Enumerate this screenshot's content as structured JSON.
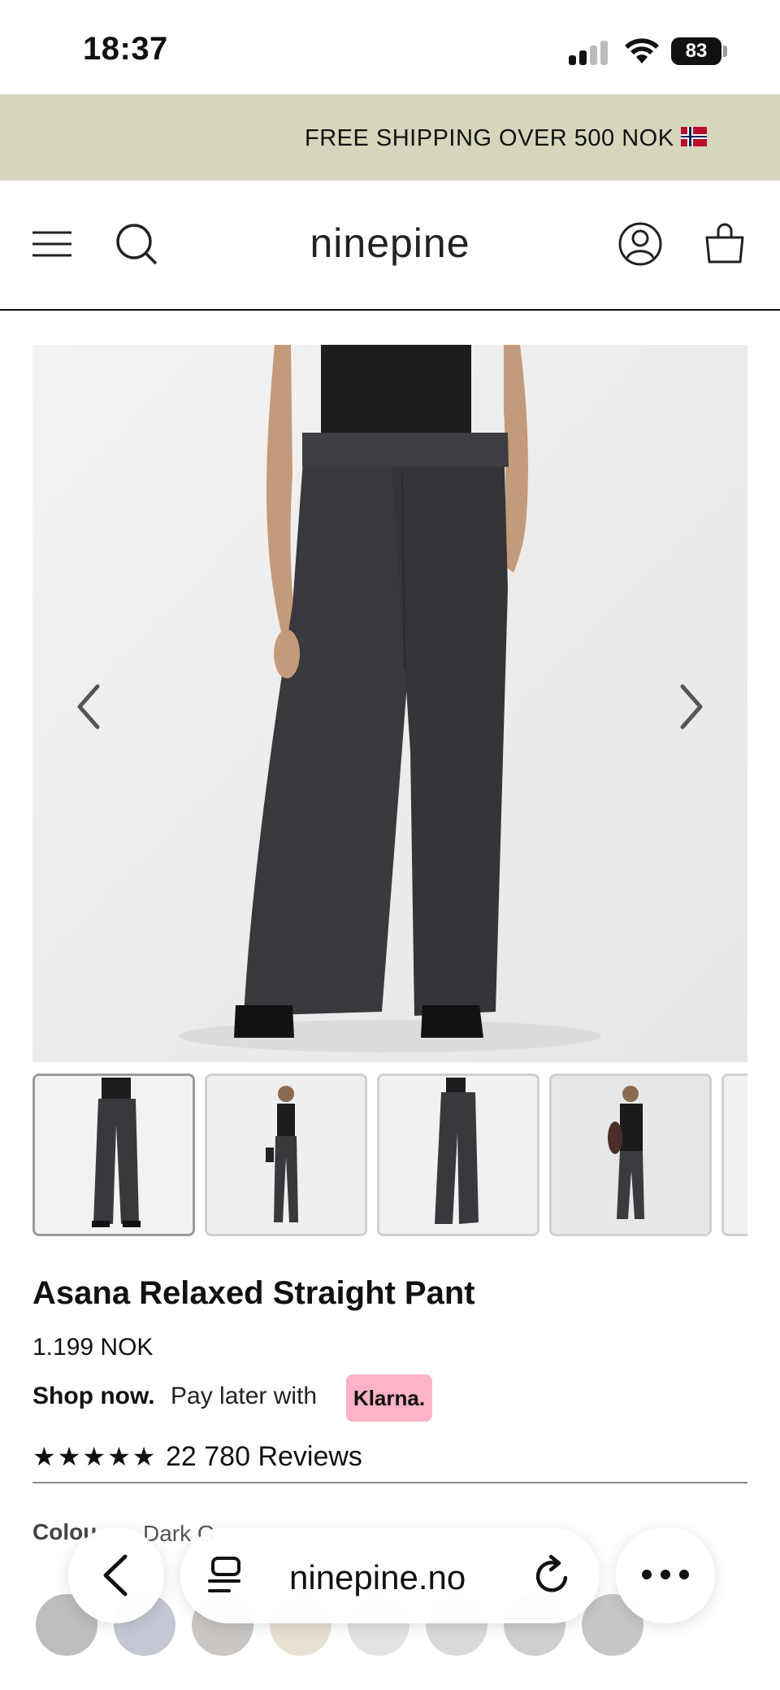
{
  "status_bar": {
    "time": "18:37",
    "battery": "83"
  },
  "announcement": {
    "text": "FREE SHIPPING OVER 500 NOK",
    "flag_icon": "norway-flag-icon"
  },
  "header": {
    "logo": "ninepine",
    "icons": [
      "menu-icon",
      "search-icon",
      "account-icon",
      "bag-icon"
    ]
  },
  "gallery": {
    "prev_icon": "chevron-left-icon",
    "next_icon": "chevron-right-icon",
    "thumbnail_count": 5
  },
  "product": {
    "title": "Asana Relaxed Straight Pant",
    "price": "1.199 NOK",
    "shop_now": "Shop now.",
    "pay_later": "Pay later with",
    "klarna": "Klarna.",
    "stars": "★★★★★",
    "reviews": "22 780 Reviews",
    "colour_label": "Colou",
    "colour_value": "Dark G"
  },
  "swatches": {
    "colors": [
      "#bdbdbd",
      "#c4c8d4",
      "#c9c6c4",
      "#e8e0d2",
      "#e3e3e1",
      "#d9d9d9",
      "#cfcfcf",
      "#c7c7c7"
    ]
  },
  "browser": {
    "url": "ninepine.no",
    "back_icon": "back-icon",
    "tabs_icon": "reader-icon",
    "reload_icon": "reload-icon",
    "more_icon": "more-icon"
  },
  "colors": {
    "announce_bg": "#d6d6bd",
    "klarna_pink": "#ffb3c7",
    "pant_color": "#3a3b3e"
  }
}
